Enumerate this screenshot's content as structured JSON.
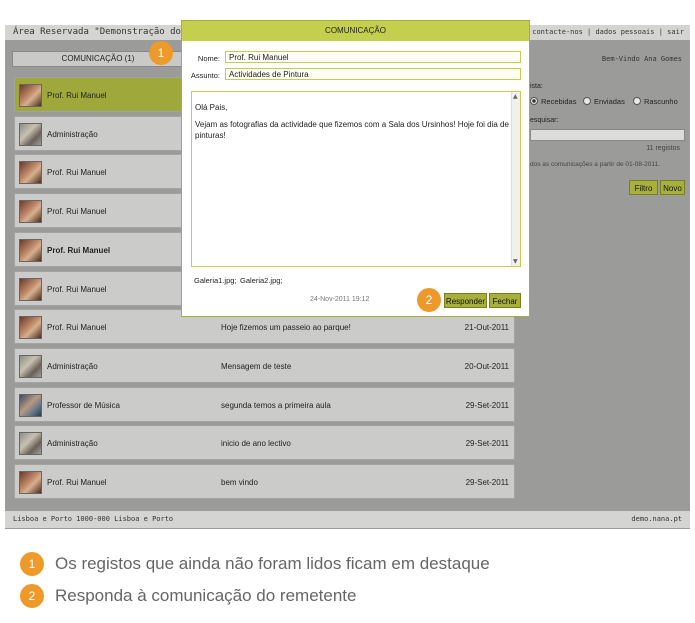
{
  "app": {
    "title": "Área Reservada \"Demonstração do Nana\"",
    "top_links": [
      "contacte-nos",
      "dados pessoais",
      "sair"
    ],
    "tab_label": "COMUNICAÇÃO (1)",
    "welcome": "Bem-Vindo Ana Gomes"
  },
  "messages": [
    {
      "name": "Prof. Rui Manuel",
      "avatar": "teacher-avatar",
      "subject": "",
      "date": "",
      "highlight": true,
      "bold": false
    },
    {
      "name": "Administração",
      "avatar": "admin-avatar",
      "subject": "",
      "date": "",
      "highlight": false,
      "bold": false
    },
    {
      "name": "Prof. Rui Manuel",
      "avatar": "teacher-avatar",
      "subject": "",
      "date": "",
      "highlight": false,
      "bold": false
    },
    {
      "name": "Prof. Rui Manuel",
      "avatar": "teacher-avatar",
      "subject": "",
      "date": "",
      "highlight": false,
      "bold": false
    },
    {
      "name": "Prof. Rui Manuel",
      "avatar": "teacher-avatar",
      "subject": "",
      "date": "",
      "highlight": false,
      "bold": true
    },
    {
      "name": "Prof. Rui Manuel",
      "avatar": "teacher-avatar",
      "subject": "",
      "date": "",
      "highlight": false,
      "bold": false
    },
    {
      "name": "Prof. Rui Manuel",
      "avatar": "teacher-avatar",
      "subject": "Hoje fizemos um passeio ao parque!",
      "date": "21-Out-2011",
      "highlight": false,
      "bold": false
    },
    {
      "name": "Administração",
      "avatar": "admin-avatar",
      "subject": "Mensagem de teste",
      "date": "20-Out-2011",
      "highlight": false,
      "bold": false
    },
    {
      "name": "Professor de Música",
      "avatar": "music-teacher-avatar",
      "subject": "segunda temos a primeira aula",
      "date": "29-Set-2011",
      "highlight": false,
      "bold": false
    },
    {
      "name": "Administração",
      "avatar": "admin-avatar",
      "subject": "inicio de ano lectivo",
      "date": "29-Set-2011",
      "highlight": false,
      "bold": false
    },
    {
      "name": "Prof. Rui Manuel",
      "avatar": "teacher-avatar",
      "subject": "bem vindo",
      "date": "29-Set-2011",
      "highlight": false,
      "bold": false
    }
  ],
  "sidebar": {
    "list_label": "ista:",
    "radios": [
      {
        "label": "Recebidas",
        "selected": true
      },
      {
        "label": "Enviadas",
        "selected": false
      },
      {
        "label": "Rascunho",
        "selected": false
      }
    ],
    "search_label": "esquisar:",
    "count": "11 registos",
    "since": "dos as comunicações a partir de 01-08-2011.",
    "filter_button": "Filtro",
    "new_button": "Novo"
  },
  "footer": {
    "address": "Lisboa e Porto 1000-000 Lisboa e Porto",
    "site": "demo.nana.pt"
  },
  "modal": {
    "header": "COMUNICAÇÃO",
    "name_label": "Nome:",
    "name_value": "Prof. Rui Manuel",
    "subject_label": "Assunto:",
    "subject_value": "Actividades de Pintura",
    "greeting": "Olá Pais,",
    "body": "Vejam as fotografias da actividade que fizemos com a Sala dos Ursinhos! Hoje foi dia de pinturas!",
    "attachments": [
      "Galeria1.jpg;",
      "Galeria2.jpg;"
    ],
    "date": "24-Nov-2011 19:12",
    "reply_button": "Responder",
    "close_button": "Fechar"
  },
  "badges": [
    "1",
    "2"
  ],
  "captions": [
    "Os registos que ainda não foram lidos ficam em destaque",
    "Responda à comunicação do remetente"
  ],
  "colors": {
    "accent": "#c4cf4e",
    "highlight_row": "#9fa93b",
    "badge": "#ee9a2a",
    "app_background": "#9b9c9a"
  }
}
